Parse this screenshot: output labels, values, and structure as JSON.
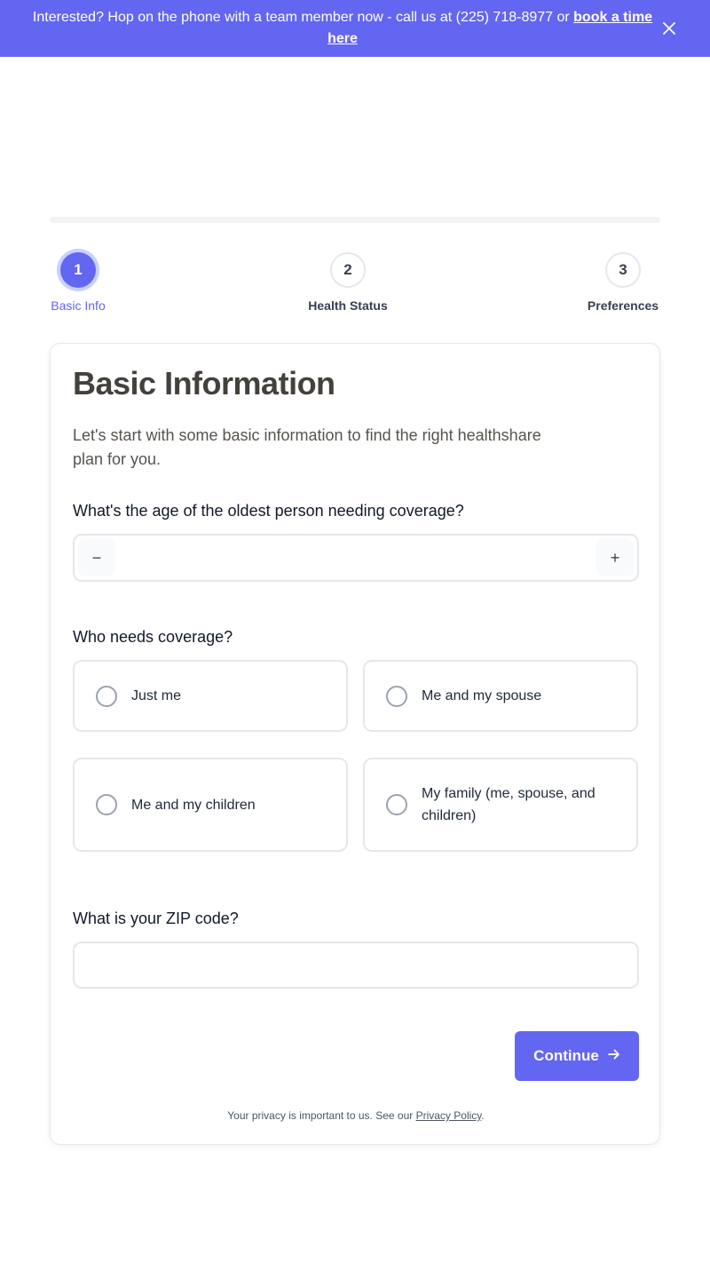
{
  "banner": {
    "text": "Interested? Hop on the phone with a team member now - call us at (225) 718-8977 or ",
    "link_text": "book a time here",
    "close_icon": "close-icon"
  },
  "steps": [
    {
      "number": "1",
      "label": "Basic Info",
      "state": "active"
    },
    {
      "number": "2",
      "label": "Health Status",
      "state": "upcoming"
    },
    {
      "number": "3",
      "label": "Preferences",
      "state": "upcoming"
    }
  ],
  "progress": {
    "fraction": 0
  },
  "form": {
    "title": "Basic Information",
    "description": "Let's start with some basic information to find the right healthshare plan for you.",
    "age": {
      "label": "What's the age of the oldest person needing coverage?",
      "value": "",
      "decrement_symbol": "−",
      "increment_symbol": "+"
    },
    "coverage": {
      "label": "Who needs coverage?",
      "options": [
        {
          "label": "Just me",
          "selected": false
        },
        {
          "label": "Me and my spouse",
          "selected": false
        },
        {
          "label": "Me and my children",
          "selected": false
        },
        {
          "label": "My family (me, spouse, and children)",
          "selected": false
        }
      ]
    },
    "zip": {
      "label": "What is your ZIP code?",
      "value": ""
    },
    "continue_label": "Continue",
    "privacy_text": "Your privacy is important to us. See our ",
    "privacy_link": "Privacy Policy",
    "privacy_end": "."
  },
  "colors": {
    "accent": "#6366f1",
    "accent_ring": "#c7d2fe",
    "border": "#e5e7eb"
  }
}
